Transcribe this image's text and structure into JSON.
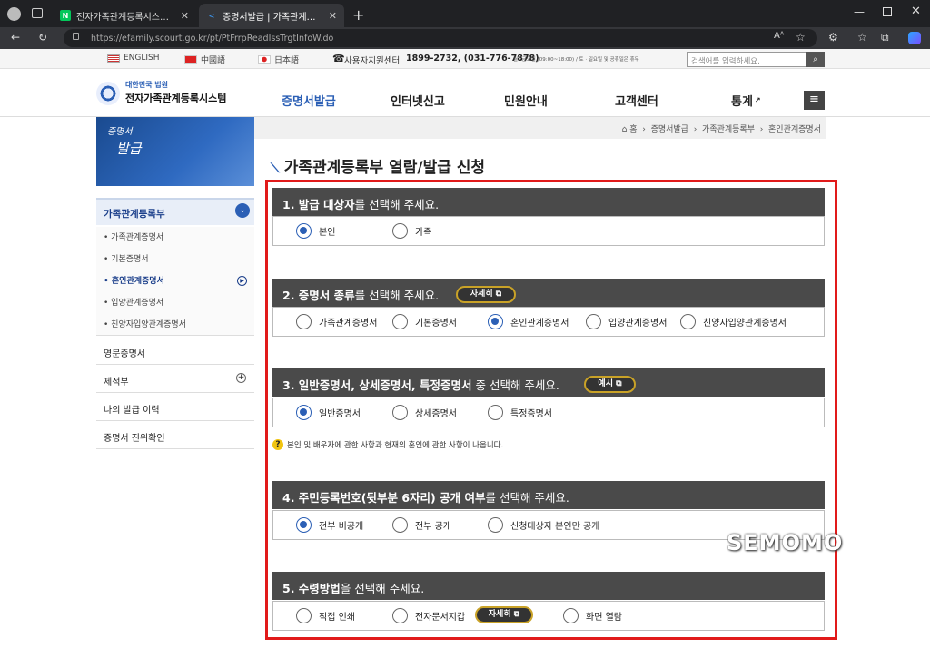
{
  "browser": {
    "tabs": [
      {
        "label": "전자가족관계등록시스템 : 네이버",
        "favicon": "N"
      },
      {
        "label": "증명서발급 | 가족관계등록부 | 혼",
        "favicon": "<"
      }
    ],
    "url": "https://efamily.scourt.go.kr/pt/PtFrrpReadIssTrgtInfoW.do"
  },
  "topbar": {
    "lang_english": "ENGLISH",
    "lang_chinese": "中國語",
    "lang_japanese": "日本語",
    "support_label": "사용자지원센터",
    "support_phone": "1899-2732, (031-776-7878)",
    "support_hours": "월~금요일 (09:00~18:00) / 토 · 일요일 및 공휴일은 휴무",
    "search_placeholder": "검색어를 입력하세요."
  },
  "header": {
    "logo_sub": "대한민국 법원",
    "logo_title": "전자가족관계등록시스템",
    "nav": [
      "증명서발급",
      "인터넷신고",
      "민원안내",
      "고객센터",
      "통계"
    ],
    "active_color": "#2b5fb5"
  },
  "banner": {
    "text_line1": "증명서",
    "text_line2": "발급"
  },
  "breadcrumb": [
    "홈",
    "증명서발급",
    "가족관계등록부",
    "혼인관계증명서"
  ],
  "sidebar": {
    "head": "가족관계등록부",
    "sub_items": [
      "가족관계증명서",
      "기본증명서",
      "혼인관계증명서",
      "입양관계증명서",
      "친양자입양관계증명서"
    ],
    "main_items": [
      "영문증명서",
      "제적부",
      "나의 발급 이력",
      "증명서 진위확인"
    ]
  },
  "page_title": "가족관계등록부 열람/발급 신청",
  "sections": [
    {
      "bold": "1. 발급 대상자",
      "rest": "를 선택해 주세요.",
      "options": [
        "본인",
        "가족"
      ],
      "selected": "본인"
    },
    {
      "bold": "2. 증명서 종류",
      "rest": "를 선택해 주세요.",
      "pill": "자세히",
      "options": [
        "가족관계증명서",
        "기본증명서",
        "혼인관계증명서",
        "입양관계증명서",
        "친양자입양관계증명서"
      ],
      "selected": "혼인관계증명서"
    },
    {
      "bold": "3. 일반증명서, 상세증명서, 특정증명서",
      "rest": " 중 선택해 주세요.",
      "pill": "예시",
      "options": [
        "일반증명서",
        "상세증명서",
        "특정증명서"
      ],
      "selected": "일반증명서"
    },
    {
      "bold": "4. 주민등록번호(뒷부분 6자리) 공개 여부",
      "rest": "를 선택해 주세요.",
      "options": [
        "전부 비공개",
        "전부 공개",
        "신청대상자 본인만 공개"
      ],
      "selected": "전부 비공개"
    },
    {
      "bold": "5. 수령방법",
      "rest": "을 선택해 주세요.",
      "pill": "자세히",
      "options": [
        "직접 인쇄",
        "전자문서지갑",
        "화면 열람"
      ],
      "selected": ""
    }
  ],
  "note": "본인 및 배우자에 관한 사항과 현재의 혼인에 관한 사항이 나옵니다.",
  "watermark": "SEMOMO"
}
